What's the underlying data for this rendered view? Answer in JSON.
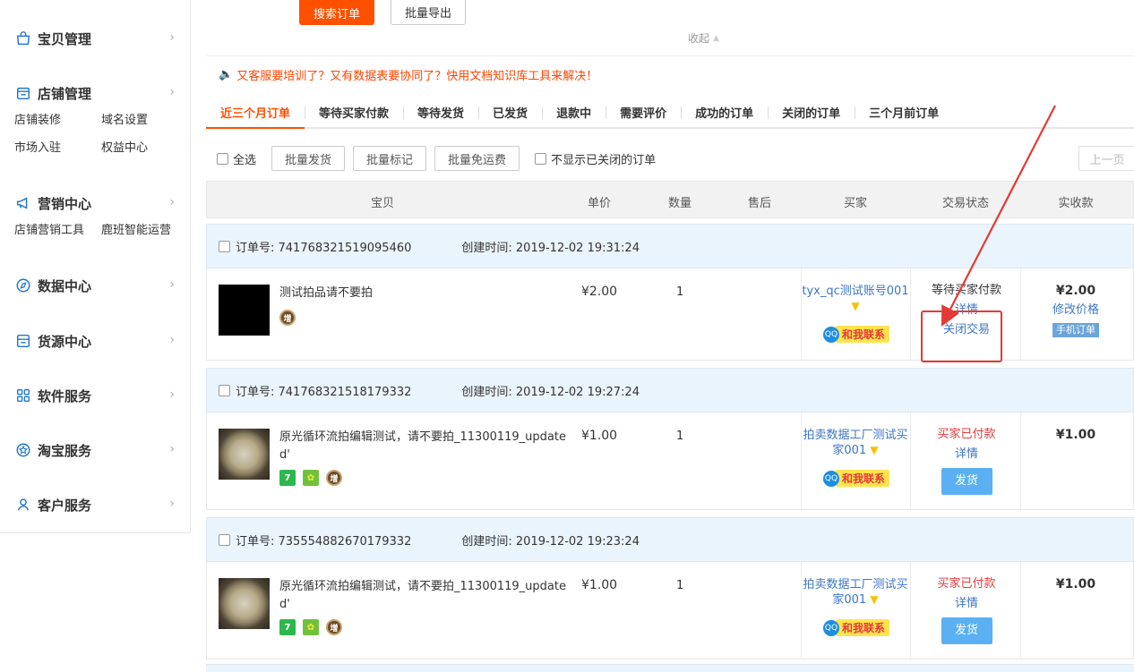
{
  "sidebar": {
    "groups": [
      {
        "label": "宝贝管理",
        "icon": "bag-icon",
        "links": []
      },
      {
        "label": "店铺管理",
        "icon": "shop-icon",
        "links": [
          "店铺装修",
          "域名设置",
          "市场入驻",
          "权益中心"
        ]
      },
      {
        "label": "营销中心",
        "icon": "megaphone-icon",
        "links": [
          "店铺营销工具",
          "鹿班智能运营"
        ]
      },
      {
        "label": "数据中心",
        "icon": "compass-icon",
        "links": []
      },
      {
        "label": "货源中心",
        "icon": "inbox-icon",
        "links": []
      },
      {
        "label": "软件服务",
        "icon": "grid-icon",
        "links": []
      },
      {
        "label": "淘宝服务",
        "icon": "star-badge-icon",
        "links": []
      },
      {
        "label": "客户服务",
        "icon": "person-icon",
        "links": []
      }
    ]
  },
  "actions": {
    "search": "搜索订单",
    "export": "批量导出",
    "collapse": "收起"
  },
  "notice": "又客服要培训了？又有数据表要协同了？快用文档知识库工具来解决！",
  "tabs": [
    "近三个月订单",
    "等待买家付款",
    "等待发货",
    "已发货",
    "退款中",
    "需要评价",
    "成功的订单",
    "关闭的订单",
    "三个月前订单"
  ],
  "toolbar": {
    "select_all": "全选",
    "bulk_ship": "批量发货",
    "bulk_mark": "批量标记",
    "bulk_free_shipping": "批量免运费",
    "hide_closed": "不显示已关闭的订单",
    "prev": "上一页"
  },
  "table_headers": [
    "宝贝",
    "单价",
    "数量",
    "售后",
    "买家",
    "交易状态",
    "实收款"
  ],
  "orders": [
    {
      "order_no": "订单号: 741768321519095460",
      "created": "创建时间: 2019-12-02 19:31:24",
      "title": "测试拍品请不要拍",
      "price": "¥2.00",
      "qty": "1",
      "buyer": "tyx_qc测试账号001",
      "contact": "和我联系",
      "status": "等待买家付款",
      "detail": "详情",
      "action": "关闭交易",
      "paid": "¥2.00",
      "paid_action": "修改价格",
      "tag": "手机订单"
    },
    {
      "order_no": "订单号: 741768321518179332",
      "created": "创建时间: 2019-12-02 19:27:24",
      "title": "原光循环流拍编辑测试，请不要拍_11300119_updated'",
      "price": "¥1.00",
      "qty": "1",
      "buyer": "拍卖数据工厂测试买家001",
      "contact": "和我联系",
      "status": "买家已付款",
      "detail": "详情",
      "action": "发货",
      "paid": "¥1.00"
    },
    {
      "order_no": "订单号: 735554882670179332",
      "created": "创建时间: 2019-12-02 19:23:24",
      "title": "原光循环流拍编辑测试，请不要拍_11300119_updated'",
      "price": "¥1.00",
      "qty": "1",
      "buyer": "拍卖数据工厂测试买家001",
      "contact": "和我联系",
      "status": "买家已付款",
      "detail": "详情",
      "action": "发货",
      "paid": "¥1.00"
    }
  ],
  "badges": {
    "zeng": "增",
    "seven": "7",
    "qq": "QQ"
  },
  "colors": {
    "accent": "#ff5000",
    "link": "#3c76c5",
    "alert": "#e4393c",
    "order_head_bg": "#eaf4fc",
    "annotation": "#e53935"
  }
}
